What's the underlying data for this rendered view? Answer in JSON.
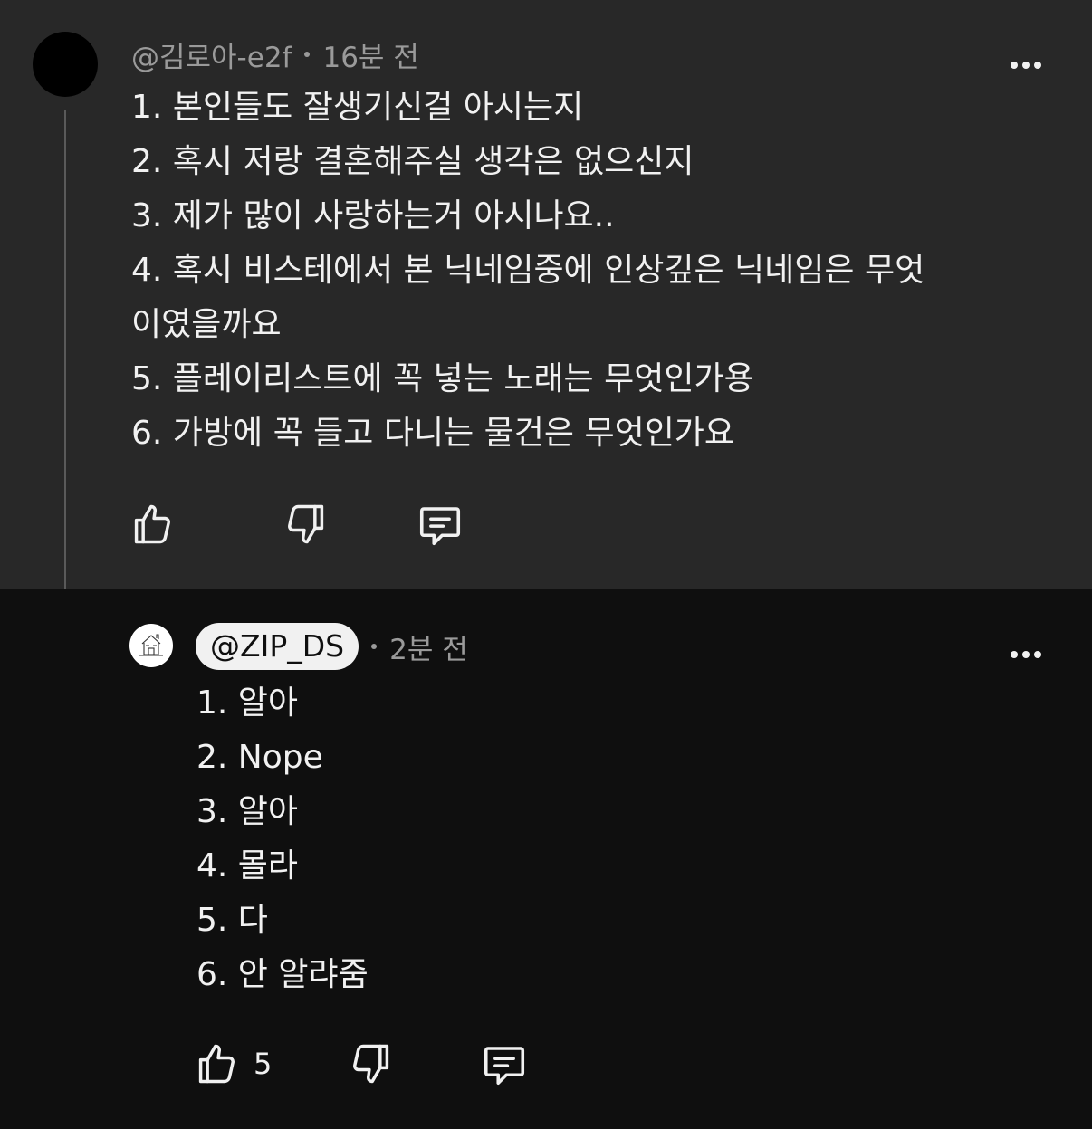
{
  "parent_comment": {
    "author": "@김로아-e2f",
    "time": "16분 전",
    "lines": [
      "1. 본인들도 잘생기신걸 아시는지",
      "2. 혹시 저랑 결혼해주실 생각은 없으신지",
      "3. 제가 많이 사랑하는거 아시나요..",
      "4. 혹시 비스테에서 본 닉네임중에 인상깊은 닉네임은 무엇",
      "이였을까요",
      "5. 플레이리스트에 꼭 넣는 노래는 무엇인가용",
      "6. 가방에 꼭 들고 다니는 물건은 무엇인가요"
    ],
    "icons": [
      "thumb-up-icon",
      "thumb-down-icon",
      "reply-icon",
      "more-vert-icon"
    ]
  },
  "reply_comment": {
    "author": "@ZIP_DS",
    "time": "2분 전",
    "lines": [
      "1. 알아",
      "2. Nope",
      "3. 알아",
      "4. 몰라",
      "5. 다",
      "6. 안 알랴줌"
    ],
    "like_count": "5",
    "icons": [
      "thumb-up-icon",
      "thumb-down-icon",
      "reply-icon",
      "more-vert-icon"
    ]
  },
  "colors": {
    "parent_bg": "#282828",
    "page_bg": "#0f0f0f",
    "text": "#f1f1f1",
    "meta_text": "#9a9a9a",
    "author_chip_bg": "#f1f1f1"
  }
}
